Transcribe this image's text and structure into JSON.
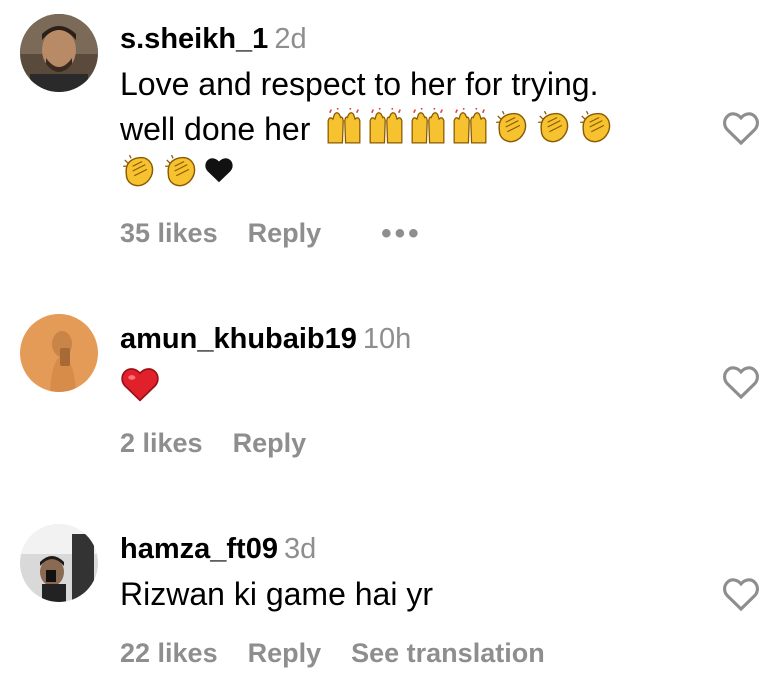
{
  "comments": [
    {
      "username": "s.sheikh_1",
      "time": "2d",
      "text": "Love and respect to her for trying.",
      "text2": "well done her",
      "emojis_line1": [
        "raising-hands",
        "raising-hands",
        "raising-hands",
        "raising-hands",
        "clapping-hands",
        "clapping-hands",
        "clapping-hands"
      ],
      "emojis_line2": [
        "clapping-hands",
        "clapping-hands",
        "black-heart"
      ],
      "likes": "35 likes",
      "reply": "Reply",
      "more": "•••"
    },
    {
      "username": "amun_khubaib19",
      "time": "10h",
      "emoji": "red-heart",
      "likes": "2 likes",
      "reply": "Reply"
    },
    {
      "username": "hamza_ft09",
      "time": "3d",
      "text": "Rizwan ki game hai yr",
      "likes": "22 likes",
      "reply": "Reply",
      "see_translation": "See translation"
    }
  ],
  "colors": {
    "secondary_text": "#8e8e8e",
    "red_heart": "#e0202a",
    "emoji_yellow": "#f7c230"
  }
}
